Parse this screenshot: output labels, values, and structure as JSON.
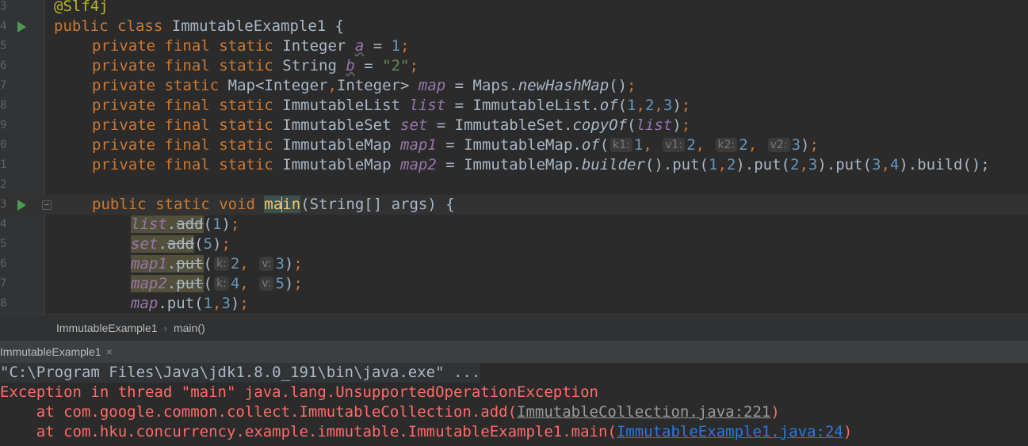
{
  "editor": {
    "line_numbers": [
      "3",
      "4",
      "5",
      "6",
      "7",
      "8",
      "9",
      "0",
      "1",
      "2",
      "3",
      "4",
      "5",
      "6",
      "7",
      "8"
    ],
    "tokens": {
      "annotation": "@Slf4j",
      "public": "public",
      "class": "class",
      "private": "private",
      "final": "final",
      "static": "static",
      "void": "void",
      "class_name": "ImmutableExample1",
      "open_brace": " {",
      "Integer": "Integer",
      "String": "String",
      "var_a": "a",
      "var_b": "b",
      "eq": " = ",
      "semi": ";",
      "num_1": "1",
      "num_2": "2",
      "num_3": "3",
      "num_4": "4",
      "num_5": "5",
      "str_2": "\"2\"",
      "map_type": "Map<Integer",
      "map_type_rest": "Integer>",
      "comma": ",",
      "map": "map",
      "Maps": "Maps.",
      "newHashMap": "newHashMap",
      "paren_open": "(",
      "paren_close": ")",
      "parens_empty": "()",
      "ImmutableList": "ImmutableList",
      "list": "list",
      "ImmutableList_dot": "ImmutableList.",
      "of": "of",
      "ImmutableSet": "ImmutableSet",
      "set": "set",
      "ImmutableSet_dot": "ImmutableSet.",
      "copyOf": "copyOf",
      "ImmutableMap": "ImmutableMap",
      "map1": "map1",
      "map2": "map2",
      "ImmutableMap_dot": "ImmutableMap.",
      "hint_k1": "k1:",
      "hint_v1": "v1:",
      "hint_k2": "k2:",
      "hint_v2": "v2:",
      "hint_k": "k:",
      "hint_v": "v:",
      "builder": "builder",
      "put_chain_1": ".put(",
      "put_chain_2": ").put(",
      "put_chain_3": ").put(",
      "build_tail": ").build();",
      "main_ma": "ma",
      "main_in": "in",
      "main_args": "(String[] args) {",
      "dot": ".",
      "add": "add",
      "put": "put",
      "map_put_call": ".put("
    }
  },
  "breadcrumb": {
    "class": "ImmutableExample1",
    "separator": "›",
    "method": "main()"
  },
  "console_tab": {
    "label": "ImmutableExample1",
    "close": "×"
  },
  "console": {
    "command": "\"C:\\Program Files\\Java\\jdk1.8.0_191\\bin\\java.exe\" ...",
    "exception": "Exception in thread \"main\" java.lang.UnsupportedOperationException",
    "trace1_prefix": "    at com.google.common.collect.ImmutableCollection.add(",
    "trace1_link": "ImmutableCollection.java:221",
    "trace1_suffix": ")",
    "trace2_prefix": "    at com.hku.concurrency.example.immutable.ImmutableExample1.main(",
    "trace2_link": "ImmutableExample1.java:24",
    "trace2_suffix": ")"
  },
  "icons": {
    "run": "run-gutter-icon",
    "fold": "fold-icon"
  },
  "colors": {
    "keyword": "#cc7832",
    "number": "#6897bb",
    "string": "#6a8759",
    "field": "#9876aa",
    "annotation": "#bbb529",
    "error": "#ff6b68",
    "link": "#287bde"
  }
}
